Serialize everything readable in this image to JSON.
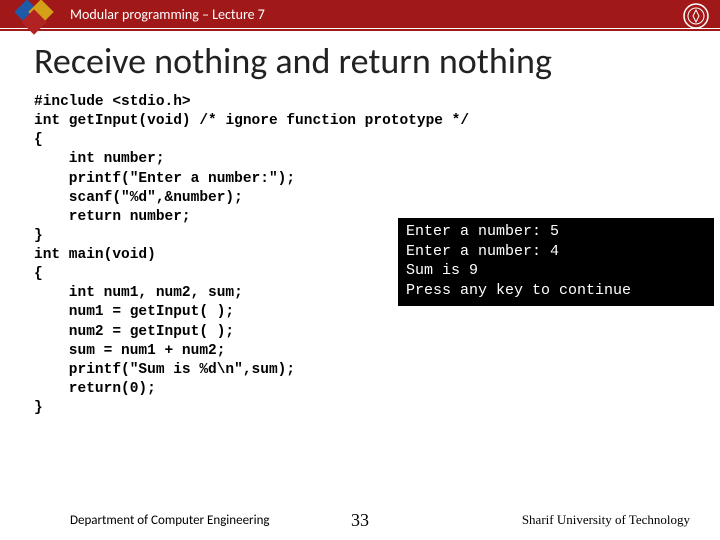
{
  "header": {
    "breadcrumb": "Modular programming – Lecture 7"
  },
  "title": "Receive nothing and return nothing",
  "code": {
    "l1": "#include <stdio.h>",
    "l2a": "int getInput(void)",
    "l2b": " /* ignore function prototype */",
    "l3": "{",
    "l4": "    int number;",
    "l5": "    printf(\"Enter a number:\");",
    "l6": "    scanf(\"%d\",&number);",
    "l7": "    return number;",
    "l8": "}",
    "l9": "int main(void)",
    "l10": "{",
    "l11": "    int num1, num2, sum;",
    "l12": "    num1 = getInput( );",
    "l13": "    num2 = getInput( );",
    "l14": "    sum = num1 + num2;",
    "l15": "    printf(\"Sum is %d\\n\",sum);",
    "l16": "    return(0);",
    "l17": "}"
  },
  "console": {
    "l1": "Enter a number: 5",
    "l2": "Enter a number: 4",
    "l3": "Sum is 9",
    "l4": "Press any key to continue"
  },
  "footer": {
    "department": "Department of Computer Engineering",
    "page": "33",
    "university": "Sharif University of Technology"
  }
}
